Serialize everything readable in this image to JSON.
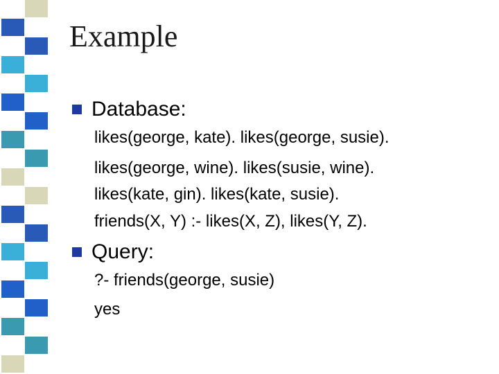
{
  "theme": {
    "stripe_colors": [
      "#1a2a8a",
      "#3a9ab0",
      "#e0e0b8",
      "#2a5ab8",
      "#6aa0b8",
      "#2060c8",
      "#1aa0d8",
      "#d8d8b8",
      "#1a2a7a",
      "#3ab0d8"
    ],
    "bullet_color": "#1e3aa0"
  },
  "slide": {
    "title": "Example",
    "sections": [
      {
        "label": "Database:",
        "lines": [
          "likes(george, kate). likes(george, susie).",
          "likes(george, wine). likes(susie, wine).",
          "likes(kate, gin). likes(kate, susie).",
          "friends(X, Y) :- likes(X, Z), likes(Y, Z)."
        ]
      },
      {
        "label": "Query:",
        "lines": [
          "?- friends(george, susie)",
          "yes"
        ]
      }
    ]
  }
}
